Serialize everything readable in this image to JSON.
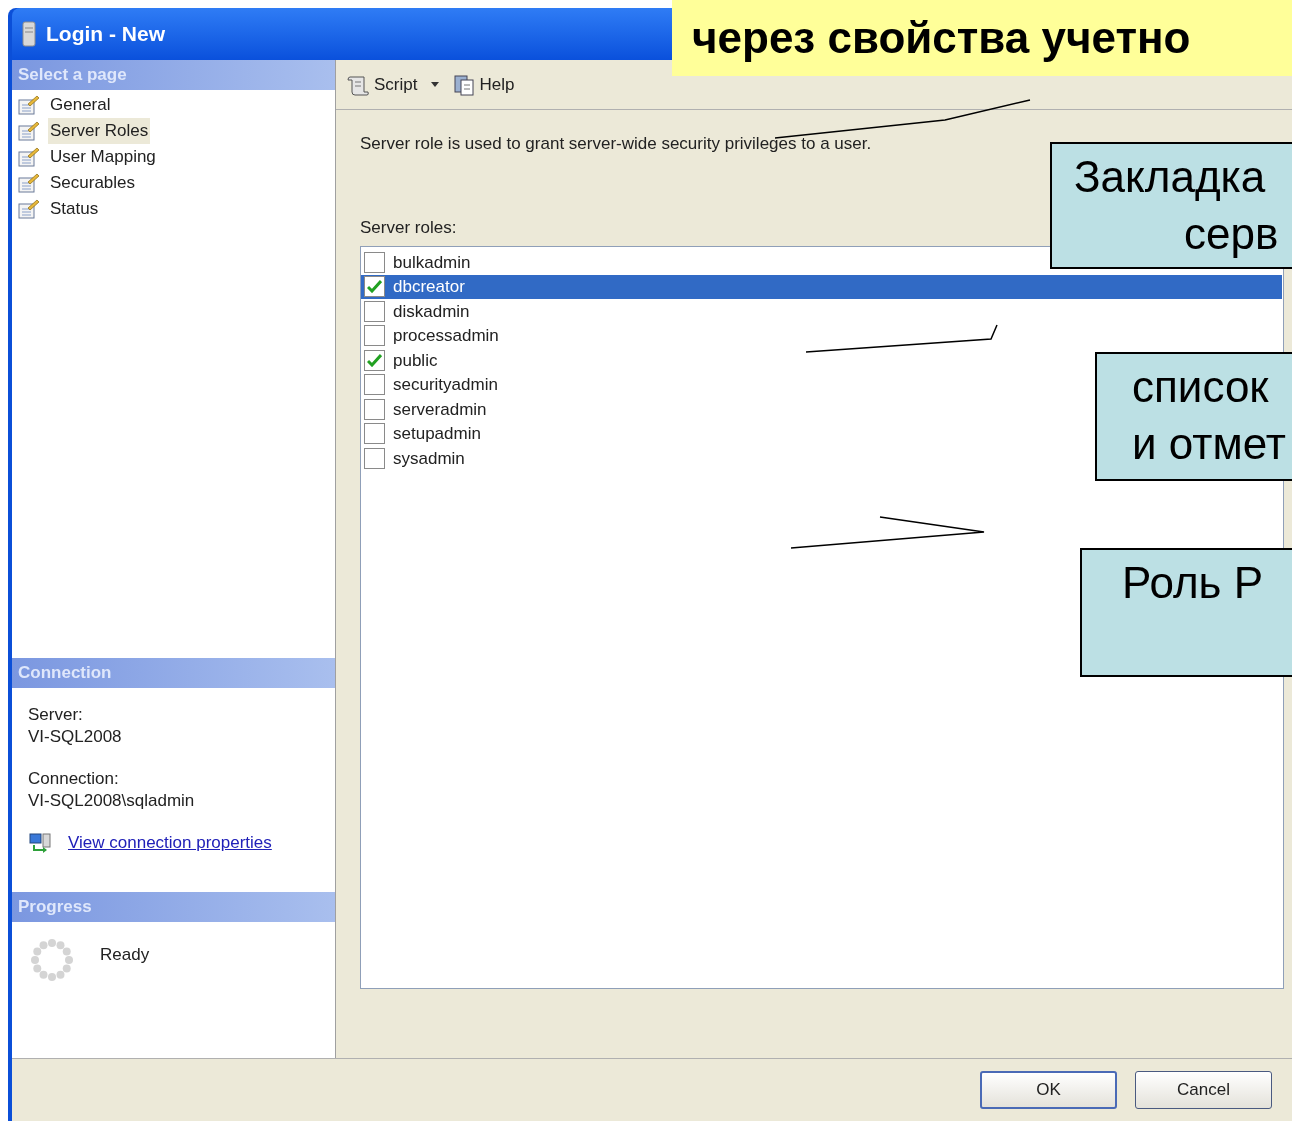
{
  "window": {
    "title": "Login - New"
  },
  "sidebar": {
    "select_page": {
      "header": "Select a page",
      "items": [
        {
          "label": "General",
          "selected": false
        },
        {
          "label": "Server Roles",
          "selected": true
        },
        {
          "label": "User Mapping",
          "selected": false
        },
        {
          "label": "Securables",
          "selected": false
        },
        {
          "label": "Status",
          "selected": false
        }
      ]
    },
    "connection": {
      "header": "Connection",
      "server_label": "Server:",
      "server": "VI-SQL2008",
      "connection_label": "Connection:",
      "connection": "VI-SQL2008\\sqladmin",
      "link": "View connection properties"
    },
    "progress": {
      "header": "Progress",
      "status": "Ready"
    }
  },
  "toolbar": {
    "script": "Script",
    "help": "Help"
  },
  "description": "Server role is used to grant server-wide security privileges to a user.",
  "server_roles": {
    "label": "Server roles:",
    "items": [
      {
        "name": "bulkadmin",
        "checked": false,
        "selected": false
      },
      {
        "name": "dbcreator",
        "checked": true,
        "selected": true
      },
      {
        "name": "diskadmin",
        "checked": false,
        "selected": false
      },
      {
        "name": "processadmin",
        "checked": false,
        "selected": false
      },
      {
        "name": "public",
        "checked": true,
        "selected": false
      },
      {
        "name": "securityadmin",
        "checked": false,
        "selected": false
      },
      {
        "name": "serveradmin",
        "checked": false,
        "selected": false
      },
      {
        "name": "setupadmin",
        "checked": false,
        "selected": false
      },
      {
        "name": "sysadmin",
        "checked": false,
        "selected": false
      }
    ]
  },
  "buttons": {
    "ok": "OK",
    "cancel": "Cancel"
  },
  "slide": {
    "banner": "через свойства учетно",
    "callouts": [
      {
        "lines": [
          "Закладка",
          "серв"
        ]
      },
      {
        "lines": [
          "список",
          "и отмет"
        ]
      },
      {
        "lines": [
          "Роль P"
        ]
      }
    ]
  }
}
